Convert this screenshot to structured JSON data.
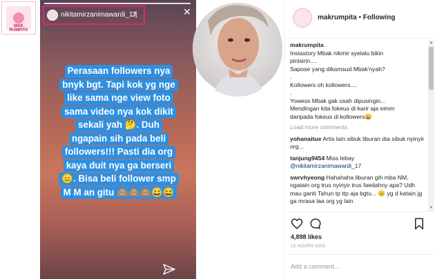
{
  "brand": {
    "logo_text": "MAK\nRUMPITA"
  },
  "story": {
    "username": "nikitamirzanimawardi_17",
    "time": "3j",
    "lines": [
      "Perasaan followers nya",
      "bnyk bgt. Tapi kok yg nge",
      "like sama nge view foto",
      "sama video nya kok dikit",
      "sekali yah 🤔. Duh",
      "ngapain sih pada beli",
      "followers!!! Pasti dia org",
      "kaya duit nya ga berseri",
      "😑. Bisa beli follower smp",
      "M M an gitu 🙈🙈🙈😅😅"
    ]
  },
  "post_header": {
    "username": "makrumpita",
    "separator": "•",
    "follow_status": "Following"
  },
  "caption": {
    "username": "makrumpita",
    "lines": [
      ".",
      "Instastory Mbak nikmir syelalu bikin",
      "pinisirin....",
      "Sapose yang dikamsud Mbak'nyah?",
      ".",
      "Kollowers oh kollowers....",
      ".",
      "Yowess Mbak gak usah dipusingin...",
      "Mendingan kita fokeus di karir aja eimm",
      "daripada fokeus di kollowers😀"
    ]
  },
  "load_more": "Load more comments",
  "comments": [
    {
      "user": "yohanaitue",
      "text": "Artis lain sibuk liburan dia sibuk nyinyir org..."
    },
    {
      "user": "tanjung9454",
      "text": "Miss lebay",
      "mention": "@nikitamirzanimawardi_17"
    },
    {
      "user": "swrvhyeong",
      "text": "Hahahaha liburan gih mba NM, ngatain org trus nyinyir trus faedahny apa? Udh mau ganti Tahun tp ttp aja bgtu... 😑 yg d katain jg ga mrasa laa org yg lain"
    }
  ],
  "likes": "4,898 likes",
  "posted_ago": "13 HOURS AGO",
  "add_comment_placeholder": "Add a comment...",
  "colors": {
    "accent_border": "#e0257a",
    "story_text_bg": "#2f8fe0"
  }
}
